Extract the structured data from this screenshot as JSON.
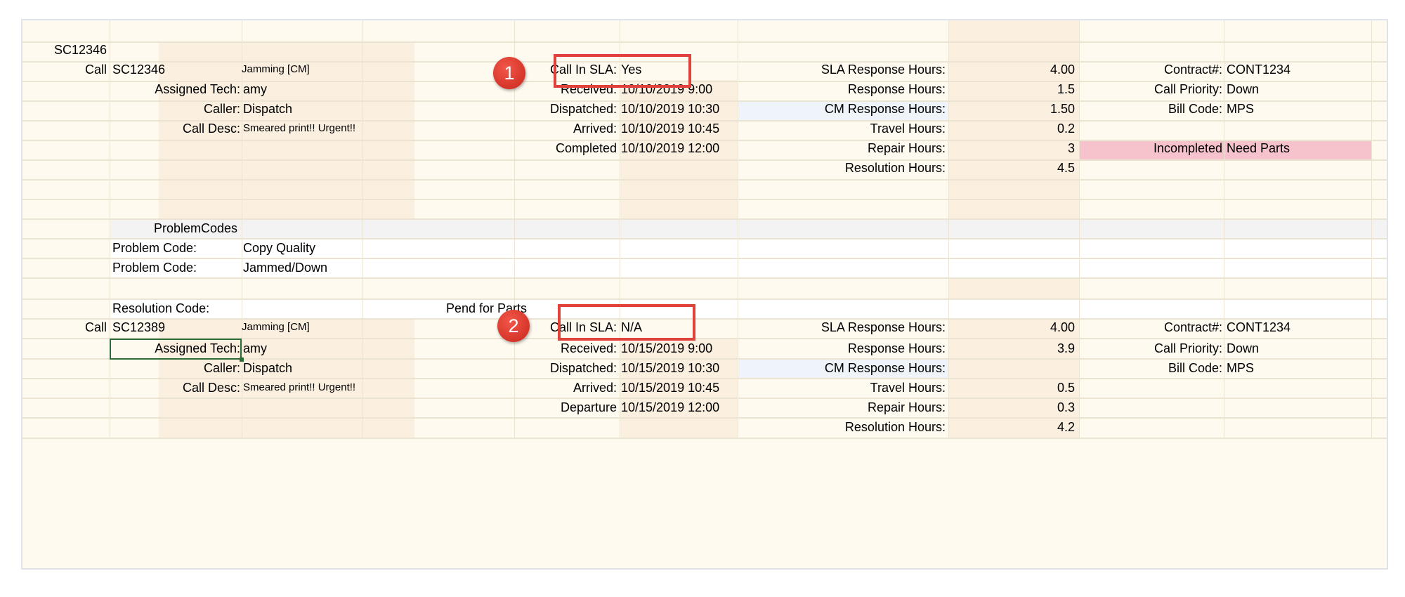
{
  "group_id": "SC12346",
  "calls": [
    {
      "row_label": "Call",
      "call_no": "SC12346",
      "problem_type": "Jamming [CM]",
      "tech_label": "Assigned Tech:",
      "tech": "amy",
      "caller_label": "Caller:",
      "caller": "Dispatch",
      "desc_label": "Call Desc:",
      "desc": "Smeared print!! Urgent!!",
      "sla_label": "Call In SLA:",
      "sla_value": "Yes",
      "marker": "1",
      "received_label": "Received:",
      "received": "10/10/2019 9:00",
      "dispatched_label": "Dispatched:",
      "dispatched": "10/10/2019 10:30",
      "arrived_label": "Arrived:",
      "arrived": "10/10/2019 10:45",
      "completed_label": "Completed",
      "completed": "10/10/2019 12:00",
      "sla_resp_label": "SLA Response Hours:",
      "sla_resp": "4.00",
      "resp_label": "Response Hours:",
      "resp": "1.5",
      "cm_resp_label": "CM Response Hours:",
      "cm_resp": "1.50",
      "travel_label": "Travel Hours:",
      "travel": "0.2",
      "repair_label": "Repair Hours:",
      "repair": "3",
      "resolution_label": "Resolution Hours:",
      "resolution": "4.5",
      "contract_label": "Contract#:",
      "contract": "CONT1234",
      "priority_label": "Call Priority:",
      "priority": "Down",
      "bill_label": "Bill Code:",
      "bill": "MPS",
      "status_label": "Incompleted",
      "status": "Need Parts"
    },
    {
      "row_label": "Call",
      "call_no": "SC12389",
      "problem_type": "Jamming [CM]",
      "tech_label": "Assigned Tech:",
      "tech": "amy",
      "caller_label": "Caller:",
      "caller": "Dispatch",
      "desc_label": "Call Desc:",
      "desc": "Smeared print!! Urgent!!",
      "sla_label": "Call In SLA:",
      "sla_value": "N/A",
      "marker": "2",
      "received_label": "Received:",
      "received": "10/15/2019 9:00",
      "dispatched_label": "Dispatched:",
      "dispatched": "10/15/2019 10:30",
      "arrived_label": "Arrived:",
      "arrived": "10/15/2019 10:45",
      "departure_label": "Departure",
      "departure": "10/15/2019 12:00",
      "sla_resp_label": "SLA Response Hours:",
      "sla_resp": "4.00",
      "resp_label": "Response Hours:",
      "resp": "3.9",
      "cm_resp_label": "CM Response Hours:",
      "travel_label": "Travel Hours:",
      "travel": "0.5",
      "repair_label": "Repair Hours:",
      "repair": "0.3",
      "resolution_label": "Resolution Hours:",
      "resolution": "4.2",
      "contract_label": "Contract#:",
      "contract": "CONT1234",
      "priority_label": "Call Priority:",
      "priority": "Down",
      "bill_label": "Bill Code:",
      "bill": "MPS"
    }
  ],
  "problem_codes": {
    "header": "ProblemCodes",
    "rows": [
      {
        "label": "Problem Code:",
        "value": "Copy Quality"
      },
      {
        "label": "Problem Code:",
        "value": "Jammed/Down"
      }
    ]
  },
  "resolution_code": {
    "label": "Resolution Code:",
    "value": "Pend for Parts"
  },
  "colors": {
    "sheet_bg": "#fffaf0",
    "callout_red": "#e0413a",
    "status_pink": "#f6c3cc",
    "cm_blue": "#eef4fa",
    "selection_green": "#2c6b36"
  }
}
